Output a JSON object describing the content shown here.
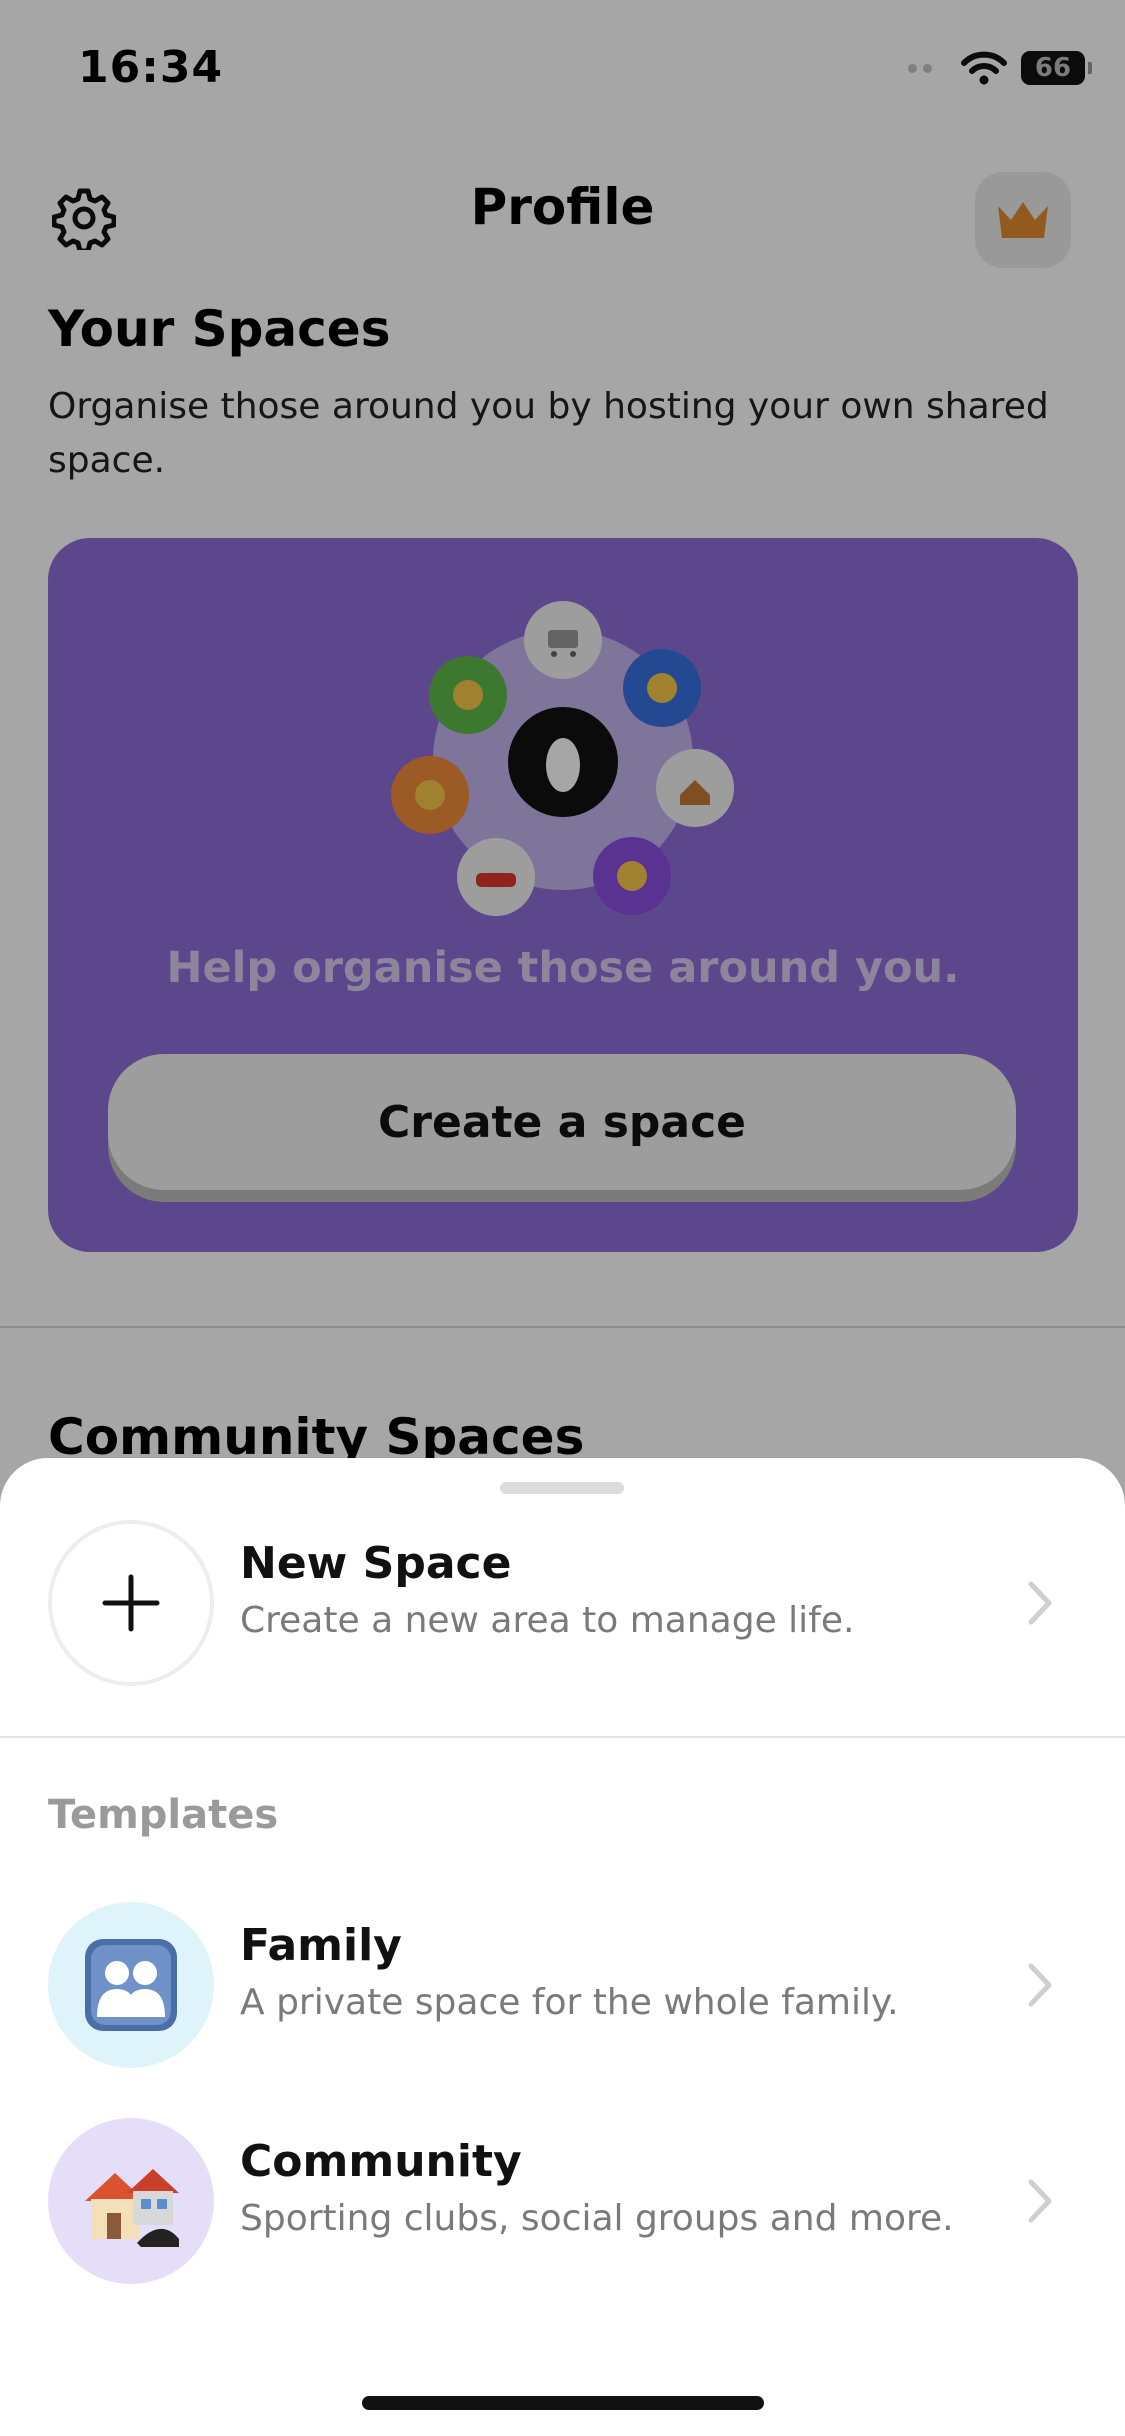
{
  "status_bar": {
    "time": "16:34",
    "battery": "66"
  },
  "header": {
    "title": "Profile",
    "settings_icon": "gear-icon",
    "premium_icon": "crown-icon"
  },
  "your_spaces": {
    "title": "Your Spaces",
    "subtitle": "Organise those around you by hosting your own shared space."
  },
  "hero": {
    "tagline": "Help organise those around you.",
    "button_label": "Create a space",
    "colors": {
      "card": "#8e6cd8",
      "center": "#000000"
    }
  },
  "community_spaces": {
    "title": "Community Spaces"
  },
  "sheet": {
    "new_space": {
      "title": "New Space",
      "subtitle": "Create a new area to manage life.",
      "icon": "plus-icon"
    },
    "templates_label": "Templates",
    "templates": [
      {
        "title": "Family",
        "subtitle": "A private space for the whole family.",
        "icon": "family-icon",
        "bg": "#dff3fb"
      },
      {
        "title": "Community",
        "subtitle": "Sporting clubs, social groups and more.",
        "icon": "houses-icon",
        "bg": "#e6def8"
      }
    ]
  }
}
